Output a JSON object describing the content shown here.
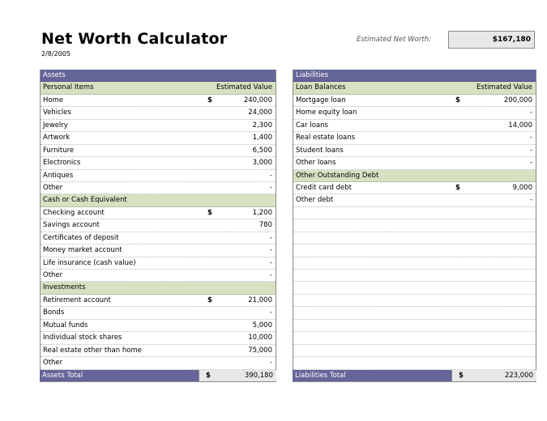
{
  "header": {
    "title": "Net Worth Calculator",
    "date": "2/8/2005",
    "net_worth_label": "Estimated Net Worth:",
    "net_worth_value": "$167,180"
  },
  "assets": {
    "title": "Assets",
    "sections": [
      {
        "label": "Personal Items",
        "column_label": "Estimated Value",
        "rows": [
          {
            "label": "Home",
            "dollar": "$",
            "value": "240,000"
          },
          {
            "label": "Vehicles",
            "dollar": "",
            "value": "24,000"
          },
          {
            "label": "Jewelry",
            "dollar": "",
            "value": "2,300"
          },
          {
            "label": "Artwork",
            "dollar": "",
            "value": "1,400"
          },
          {
            "label": "Furniture",
            "dollar": "",
            "value": "6,500"
          },
          {
            "label": "Electronics",
            "dollar": "",
            "value": "3,000"
          },
          {
            "label": "Antiques",
            "dollar": "",
            "value": "-"
          },
          {
            "label": "Other",
            "dollar": "",
            "value": "-"
          }
        ]
      },
      {
        "label": "Cash or Cash Equivalent",
        "column_label": "",
        "rows": [
          {
            "label": "Checking account",
            "dollar": "$",
            "value": "1,200"
          },
          {
            "label": "Savings account",
            "dollar": "",
            "value": "780"
          },
          {
            "label": "Certificates of deposit",
            "dollar": "",
            "value": "-"
          },
          {
            "label": "Money market account",
            "dollar": "",
            "value": "-"
          },
          {
            "label": "Life insurance (cash value)",
            "dollar": "",
            "value": "-"
          },
          {
            "label": "Other",
            "dollar": "",
            "value": "-"
          }
        ]
      },
      {
        "label": "Investments",
        "column_label": "",
        "rows": [
          {
            "label": "Retirement account",
            "dollar": "$",
            "value": "21,000"
          },
          {
            "label": "Bonds",
            "dollar": "",
            "value": "-"
          },
          {
            "label": "Mutual funds",
            "dollar": "",
            "value": "5,000"
          },
          {
            "label": "Individual stock shares",
            "dollar": "",
            "value": "10,000"
          },
          {
            "label": "Real estate other than home",
            "dollar": "",
            "value": "75,000"
          },
          {
            "label": "Other",
            "dollar": "",
            "value": "-"
          }
        ]
      }
    ],
    "total_label": "Assets Total",
    "total_dollar": "$",
    "total_value": "390,180"
  },
  "liabilities": {
    "title": "Liabilities",
    "sections": [
      {
        "label": "Loan Balances",
        "column_label": "Estimated Value",
        "rows": [
          {
            "label": "Mortgage loan",
            "dollar": "$",
            "value": "200,000"
          },
          {
            "label": "Home equity loan",
            "dollar": "",
            "value": "-"
          },
          {
            "label": "Car loans",
            "dollar": "",
            "value": "14,000"
          },
          {
            "label": "Real estate loans",
            "dollar": "",
            "value": "-"
          },
          {
            "label": "Student loans",
            "dollar": "",
            "value": "-"
          },
          {
            "label": "Other loans",
            "dollar": "",
            "value": "-"
          }
        ]
      },
      {
        "label": "Other Outstanding Debt",
        "column_label": "",
        "rows": [
          {
            "label": "Credit card debt",
            "dollar": "$",
            "value": "9,000"
          },
          {
            "label": "Other debt",
            "dollar": "",
            "value": "-"
          }
        ]
      }
    ],
    "empty_rows": 13,
    "total_label": "Liabilities Total",
    "total_dollar": "$",
    "total_value": "223,000"
  },
  "colors": {
    "header_bg": "#65659a",
    "subheader_bg": "#d6e1c2",
    "total_box_bg": "#e8e8e8"
  }
}
